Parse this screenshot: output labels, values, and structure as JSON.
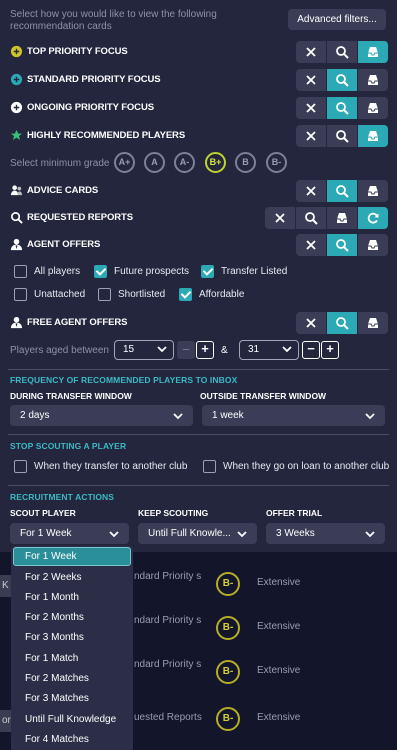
{
  "intro": "Select how you would like to view the following recommendation cards",
  "advanced_button": "Advanced filters...",
  "focus_rows": [
    {
      "label": "TOP PRIORITY FOCUS",
      "icon": "top-priority-icon"
    },
    {
      "label": "STANDARD PRIORITY FOCUS",
      "icon": "standard-priority-icon"
    },
    {
      "label": "ONGOING PRIORITY FOCUS",
      "icon": "ongoing-priority-icon"
    },
    {
      "label": "HIGHLY RECOMMENDED PLAYERS",
      "icon": "star-icon"
    }
  ],
  "grade": {
    "label": "Select minimum grade",
    "options": [
      "A+",
      "A",
      "A-",
      "B+",
      "B",
      "B-"
    ],
    "selected": "B+"
  },
  "advice_cards": {
    "label": "ADVICE CARDS"
  },
  "requested_reports": {
    "label": "REQUESTED REPORTS"
  },
  "agent_offers": {
    "label": "AGENT OFFERS",
    "checkboxes": [
      {
        "label": "All players",
        "checked": false
      },
      {
        "label": "Future prospects",
        "checked": true
      },
      {
        "label": "Transfer Listed",
        "checked": true
      },
      {
        "label": "Unattached",
        "checked": false
      },
      {
        "label": "Shortlisted",
        "checked": false
      },
      {
        "label": "Affordable",
        "checked": true
      }
    ]
  },
  "free_agent_offers": {
    "label": "FREE AGENT OFFERS",
    "age_label": "Players aged between",
    "min_age": "15",
    "max_age": "31",
    "and": "&"
  },
  "frequency": {
    "title": "FREQUENCY OF RECOMMENDED PLAYERS TO INBOX",
    "during_label": "DURING TRANSFER WINDOW",
    "during_value": "2 days",
    "outside_label": "OUTSIDE TRANSFER WINDOW",
    "outside_value": "1 week"
  },
  "stop_scouting": {
    "title": "STOP SCOUTING A PLAYER",
    "options": [
      {
        "label": "When they transfer to another club",
        "checked": false
      },
      {
        "label": "When they go on loan to another club",
        "checked": false
      }
    ]
  },
  "recruitment": {
    "title": "RECRUITMENT ACTIONS",
    "scout_label": "SCOUT PLAYER",
    "scout_value": "For 1 Week",
    "keep_label": "KEEP SCOUTING",
    "keep_value": "Until Full Knowle...",
    "trial_label": "OFFER TRIAL",
    "trial_value": "3 Weeks"
  },
  "scout_menu": {
    "items": [
      "For 1 Week",
      "For 2 Weeks",
      "For 1 Month",
      "For 2 Months",
      "For 3 Months",
      "For 1 Match",
      "For 2 Matches",
      "For 3 Matches",
      "Until Full Knowledge",
      "For 4 Matches"
    ],
    "selected_index": 0
  },
  "background_rows": [
    {
      "pill": "K",
      "label": "ndard Priority s",
      "grade": "B-",
      "status": "Extensive"
    },
    {
      "pill": "",
      "label": "ndard Priority s",
      "grade": "B-",
      "status": "Extensive"
    },
    {
      "pill": "",
      "label": "ndard Priority s",
      "grade": "B-",
      "status": "Extensive"
    },
    {
      "pill": "or",
      "label": "uested Reports",
      "grade": "B-",
      "status": "Extensive"
    }
  ],
  "colors": {
    "accent": "#2ba9b4",
    "grade_selected": "#bfd42e",
    "section_title": "#3bb9c6",
    "panel": "#23263d"
  }
}
